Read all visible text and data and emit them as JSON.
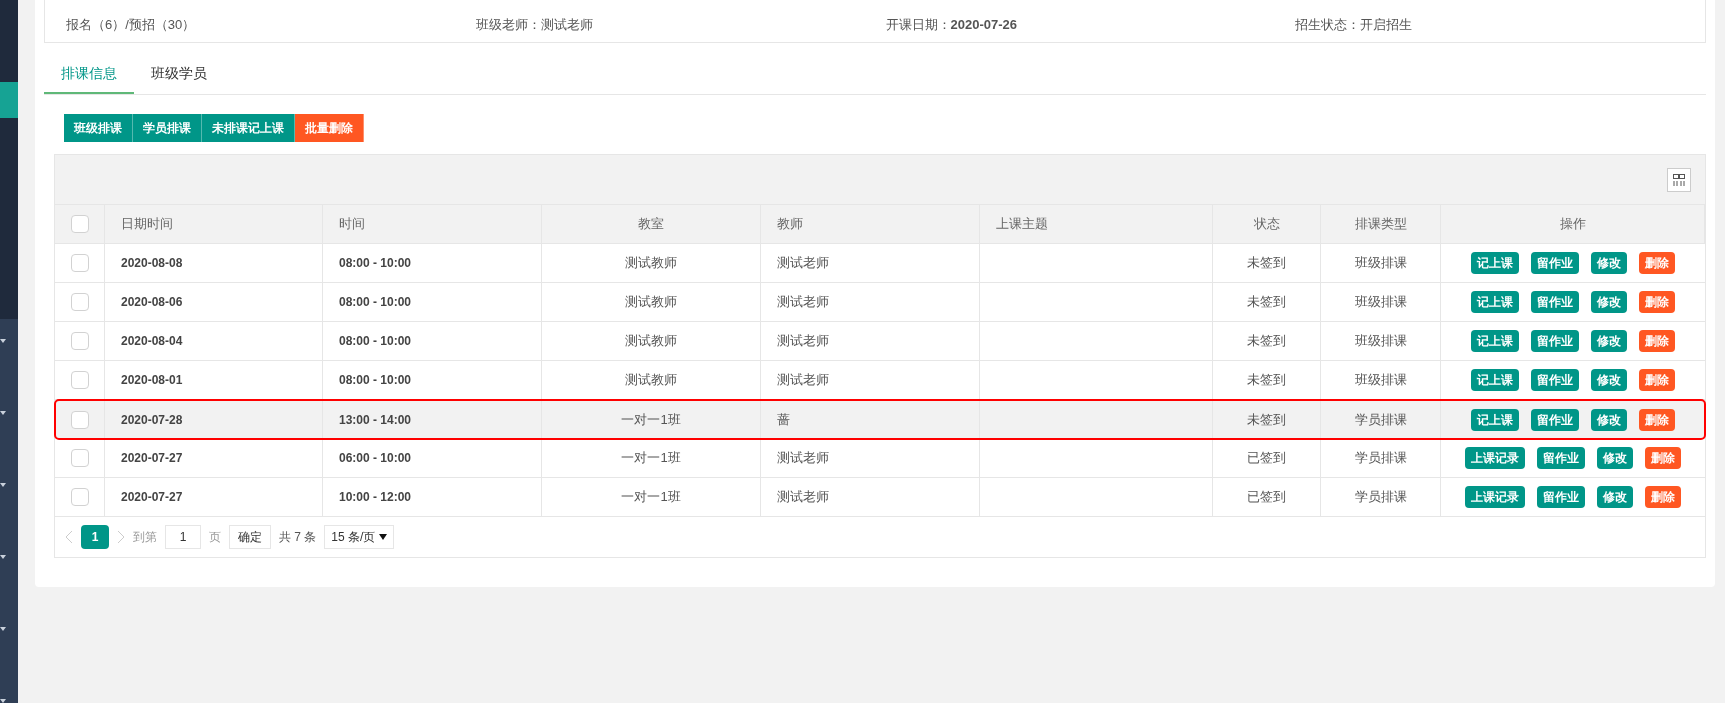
{
  "class_info": [
    {
      "label": "报名（6）/预招（30）"
    },
    {
      "label": "班级老师：",
      "value": "测试老师",
      "bold": false
    },
    {
      "label": "开课日期：",
      "value": "2020-07-26",
      "bold": true
    },
    {
      "label": "招生状态：",
      "value": "开启招生",
      "bold": false
    }
  ],
  "tabs": [
    {
      "label": "排课信息",
      "selected": true
    },
    {
      "label": "班级学员",
      "selected": false
    }
  ],
  "toolbar_buttons": [
    {
      "label": "班级排课",
      "kind": "primary"
    },
    {
      "label": "学员排课",
      "kind": "primary"
    },
    {
      "label": "未排课记上课",
      "kind": "primary"
    },
    {
      "label": "批量删除",
      "kind": "danger"
    }
  ],
  "table": {
    "all_checked": false,
    "columns": [
      "日期时间",
      "时间",
      "教室",
      "教师",
      "上课主题",
      "状态",
      "排课类型",
      "操作"
    ],
    "rows": [
      {
        "checked": false,
        "selected": false,
        "date": "2020-08-08",
        "time": "08:00 - 10:00",
        "classroom": "测试教师",
        "teacher": "测试老师",
        "topic": "",
        "status": "未签到",
        "type": "班级排课",
        "actions": [
          {
            "label": "记上课",
            "kind": "primary"
          },
          {
            "label": "留作业",
            "kind": "primary"
          },
          {
            "label": "修改",
            "kind": "primary"
          },
          {
            "label": "删除",
            "kind": "danger"
          }
        ]
      },
      {
        "checked": false,
        "selected": false,
        "date": "2020-08-06",
        "time": "08:00 - 10:00",
        "classroom": "测试教师",
        "teacher": "测试老师",
        "topic": "",
        "status": "未签到",
        "type": "班级排课",
        "actions": [
          {
            "label": "记上课",
            "kind": "primary"
          },
          {
            "label": "留作业",
            "kind": "primary"
          },
          {
            "label": "修改",
            "kind": "primary"
          },
          {
            "label": "删除",
            "kind": "danger"
          }
        ]
      },
      {
        "checked": false,
        "selected": false,
        "date": "2020-08-04",
        "time": "08:00 - 10:00",
        "classroom": "测试教师",
        "teacher": "测试老师",
        "topic": "",
        "status": "未签到",
        "type": "班级排课",
        "actions": [
          {
            "label": "记上课",
            "kind": "primary"
          },
          {
            "label": "留作业",
            "kind": "primary"
          },
          {
            "label": "修改",
            "kind": "primary"
          },
          {
            "label": "删除",
            "kind": "danger"
          }
        ]
      },
      {
        "checked": false,
        "selected": false,
        "date": "2020-08-01",
        "time": "08:00 - 10:00",
        "classroom": "测试教师",
        "teacher": "测试老师",
        "topic": "",
        "status": "未签到",
        "type": "班级排课",
        "actions": [
          {
            "label": "记上课",
            "kind": "primary"
          },
          {
            "label": "留作业",
            "kind": "primary"
          },
          {
            "label": "修改",
            "kind": "primary"
          },
          {
            "label": "删除",
            "kind": "danger"
          }
        ]
      },
      {
        "checked": false,
        "selected": true,
        "date": "2020-07-28",
        "time": "13:00 - 14:00",
        "classroom": "一对一1班",
        "teacher": "蔷",
        "topic": "",
        "status": "未签到",
        "type": "学员排课",
        "actions": [
          {
            "label": "记上课",
            "kind": "primary"
          },
          {
            "label": "留作业",
            "kind": "primary"
          },
          {
            "label": "修改",
            "kind": "primary"
          },
          {
            "label": "删除",
            "kind": "danger"
          }
        ]
      },
      {
        "checked": false,
        "selected": false,
        "date": "2020-07-27",
        "time": "06:00 - 10:00",
        "classroom": "一对一1班",
        "teacher": "测试老师",
        "topic": "",
        "status": "已签到",
        "type": "学员排课",
        "actions": [
          {
            "label": "上课记录",
            "kind": "primary"
          },
          {
            "label": "留作业",
            "kind": "primary"
          },
          {
            "label": "修改",
            "kind": "primary"
          },
          {
            "label": "删除",
            "kind": "danger"
          }
        ]
      },
      {
        "checked": false,
        "selected": false,
        "date": "2020-07-27",
        "time": "10:00 - 12:00",
        "classroom": "一对一1班",
        "teacher": "测试老师",
        "topic": "",
        "status": "已签到",
        "type": "学员排课",
        "actions": [
          {
            "label": "上课记录",
            "kind": "primary"
          },
          {
            "label": "留作业",
            "kind": "primary"
          },
          {
            "label": "修改",
            "kind": "primary"
          },
          {
            "label": "删除",
            "kind": "danger"
          }
        ]
      }
    ]
  },
  "pagination": {
    "pages": [
      {
        "label": "1",
        "selected": true
      }
    ],
    "goto_label": "到第",
    "goto_value": "1",
    "page_unit": "页",
    "confirm": "确定",
    "total": "共 7 条",
    "page_size": "15 条/页"
  }
}
